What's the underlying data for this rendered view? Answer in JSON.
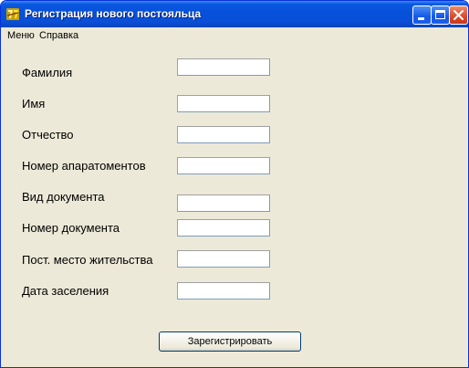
{
  "window": {
    "title": "Регистрация нового постояльца",
    "title_bar_color": "#0a54d6",
    "app_icon": "delphi-app-icon",
    "controls": [
      "minimize-icon",
      "maximize-icon",
      "close-icon"
    ]
  },
  "menu": {
    "items": [
      {
        "label": "Меню"
      },
      {
        "label": "Справка"
      }
    ]
  },
  "form": {
    "fields": [
      {
        "label": "Фамилия",
        "value": ""
      },
      {
        "label": "Имя",
        "value": ""
      },
      {
        "label": "Отчество",
        "value": ""
      },
      {
        "label": "Номер апаратоментов",
        "value": ""
      },
      {
        "label": "Вид документа",
        "value": ""
      },
      {
        "label": "Номер документа",
        "value": ""
      },
      {
        "label": "Пост. место жительства",
        "value": ""
      },
      {
        "label": "Дата заселения",
        "value": ""
      }
    ],
    "submit_label": "Зарегистрировать"
  }
}
